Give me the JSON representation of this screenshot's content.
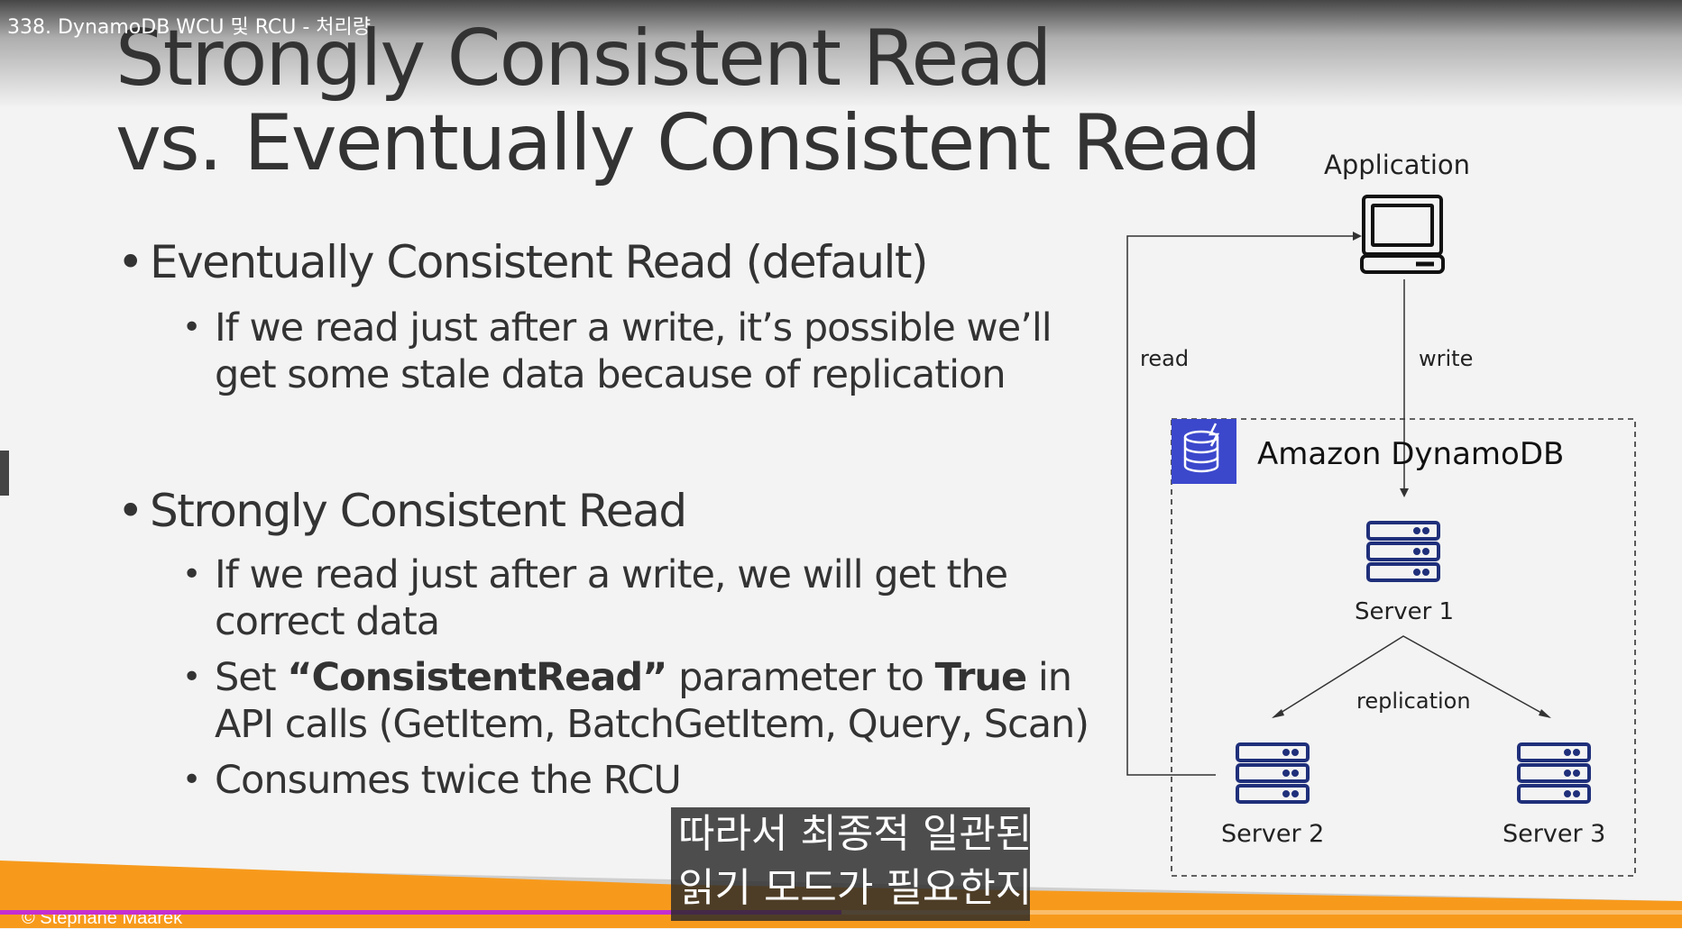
{
  "player": {
    "video_title": "338. DynamoDB WCU 및 RCU - 처리량",
    "progress_fraction": 0.5,
    "footer": "© Stephane Maarek"
  },
  "slide": {
    "title_line1": "Strongly Consistent Read",
    "title_line2": "vs. Eventually Consistent Read",
    "sections": [
      {
        "heading": "Eventually Consistent Read (default)",
        "items": [
          {
            "lines": [
              "If we read just after a write, it’s possible we’ll",
              "get some stale data because of replication"
            ]
          }
        ]
      },
      {
        "heading": "Strongly Consistent Read",
        "items": [
          {
            "lines": [
              "If we read just after a write, we will get the",
              "correct data"
            ]
          },
          {
            "parts": [
              "Set ",
              "“ConsistentRead”",
              " parameter to ",
              "True",
              " in"
            ],
            "line2": "API calls (GetItem, BatchGetItem, Query, Scan)"
          },
          {
            "lines": [
              "Consumes twice the RCU"
            ]
          }
        ]
      }
    ]
  },
  "diagram": {
    "application_label": "Application",
    "read_label": "read",
    "write_label": "write",
    "dynamodb_label": "Amazon DynamoDB",
    "server1_label": "Server 1",
    "server2_label": "Server 2",
    "server3_label": "Server 3",
    "replication_label": "replication",
    "colors": {
      "dynamodb_icon_bg": "#3b48cc",
      "line": "#333333"
    }
  },
  "subtitle": {
    "line1": "따라서 최종적 일관된",
    "line2": "읽기 모드가 필요한지"
  },
  "colors": {
    "bottom_band_orange": "#f79a1c",
    "progress_fill": "#c42fd0"
  }
}
